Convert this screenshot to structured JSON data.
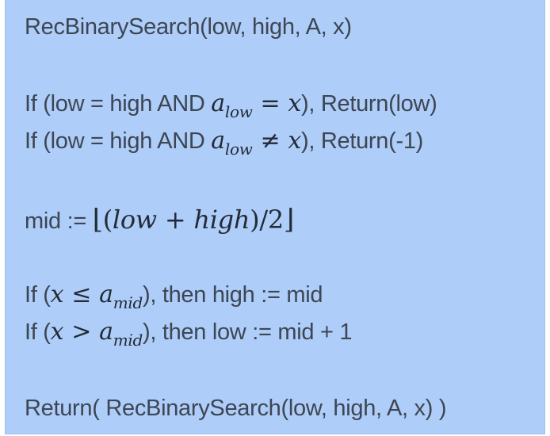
{
  "algorithm": {
    "header": "RecBinarySearch(low, high, A, x)",
    "base1": {
      "pre": "If (low = high AND ",
      "var": "a",
      "sub": "low",
      "op": "=",
      "x": "x",
      "post": "), Return(low)"
    },
    "base2": {
      "pre": "If (low = high AND ",
      "var": "a",
      "sub": "low",
      "op": "≠",
      "x": "x",
      "post": "), Return(-1)"
    },
    "mid": {
      "pre": "mid := ",
      "lfloor": "⌊",
      "lparen": "(",
      "low": "low",
      "plus": "+",
      "high": "high",
      "rparen": ")",
      "slash": "/",
      "two": "2",
      "rfloor": "⌋"
    },
    "cond1": {
      "pre": "If (",
      "x": "x",
      "op": "≤",
      "var": "a",
      "sub": "mid",
      "post": "), then high := mid"
    },
    "cond2": {
      "pre": "If (",
      "x": "x",
      "op": ">",
      "var": "a",
      "sub": "mid",
      "post": "), then low := mid + 1"
    },
    "recurse": "Return( RecBinarySearch(low, high, A, x) )"
  }
}
